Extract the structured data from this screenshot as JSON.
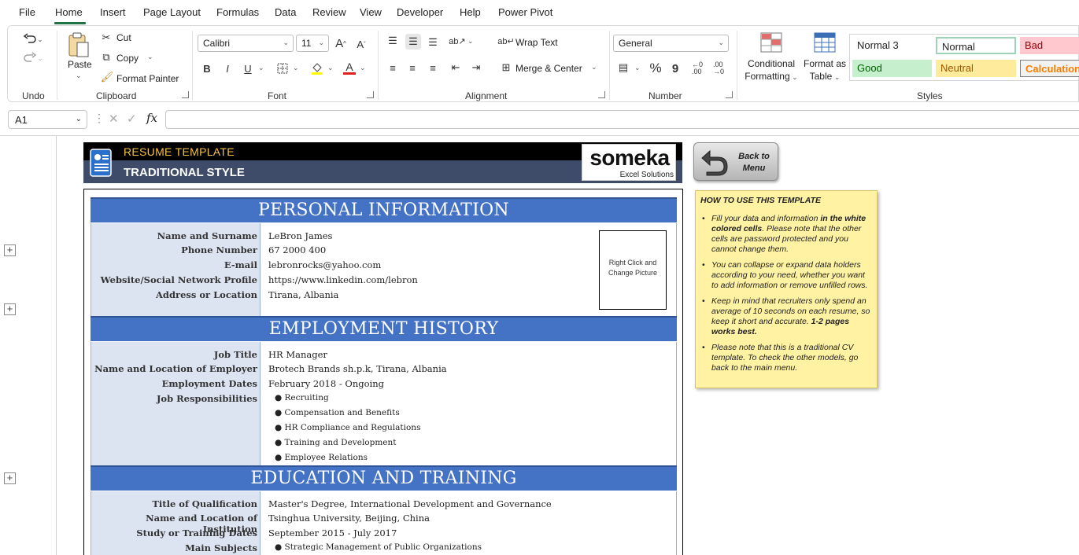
{
  "menu": {
    "items": [
      "File",
      "Home",
      "Insert",
      "Page Layout",
      "Formulas",
      "Data",
      "Review",
      "View",
      "Developer",
      "Help",
      "Power Pivot"
    ],
    "active": "Home"
  },
  "ribbon": {
    "undo": {
      "group_label": "Undo"
    },
    "clipboard": {
      "group_label": "Clipboard",
      "paste": "Paste",
      "cut": "Cut",
      "copy": "Copy",
      "format_painter": "Format Painter"
    },
    "font": {
      "group_label": "Font",
      "font_name": "Calibri",
      "font_size": "11",
      "bold": "B",
      "italic": "I",
      "underline": "U"
    },
    "alignment": {
      "group_label": "Alignment",
      "wrap_text": "Wrap Text",
      "merge_center": "Merge & Center"
    },
    "number": {
      "group_label": "Number",
      "format": "General",
      "percent": "%",
      "comma": "9"
    },
    "styles_group": {
      "group_label": "Styles",
      "conditional": [
        "Conditional",
        "Formatting"
      ],
      "format_as_table": [
        "Format as",
        "Table"
      ],
      "cells": {
        "normal3": "Normal 3",
        "normal": "Normal",
        "bad": "Bad",
        "good": "Good",
        "neutral": "Neutral",
        "calculation": "Calculation"
      }
    }
  },
  "formula_bar": {
    "name_box": "A1",
    "fx": "fx",
    "value": ""
  },
  "header": {
    "subtitle": "RESUME TEMPLATE",
    "title": "TRADITIONAL STYLE",
    "logo_name": "someka",
    "logo_tagline": "Excel Solutions"
  },
  "back_button": {
    "line1": "Back to",
    "line2": "Menu"
  },
  "resume": {
    "personal": {
      "heading": "PERSONAL INFORMATION",
      "rows": [
        {
          "label": "Name and Surname",
          "value": "LeBron James"
        },
        {
          "label": "Phone Number",
          "value": "67 2000 400"
        },
        {
          "label": "E-mail",
          "value": "lebronrocks@yahoo.com"
        },
        {
          "label": "Website/Social Network Profile",
          "value": "https://www.linkedin.com/lebron"
        },
        {
          "label": "Address or Location",
          "value": "Tirana, Albania"
        }
      ],
      "photo_text": [
        "Right Click and",
        "Change Picture"
      ]
    },
    "employment": {
      "heading": "EMPLOYMENT HISTORY",
      "rows": [
        {
          "label": "Job Title",
          "value": "HR Manager"
        },
        {
          "label": "Name and Location of Employer",
          "value": "Brotech Brands sh.p.k, Tirana, Albania"
        },
        {
          "label": "Employment Dates",
          "value": "February 2018 - Ongoing"
        },
        {
          "label": "Job Responsibilities",
          "value": ""
        }
      ],
      "responsibilities": [
        "● Recruiting",
        "● Compensation and Benefits",
        "● HR Compliance and Regulations",
        "● Training and Development",
        "● Employee Relations"
      ]
    },
    "education": {
      "heading": "EDUCATION AND TRAINING",
      "rows": [
        {
          "label": "Title of Qualification",
          "value": "Master's Degree, International Development and Governance"
        },
        {
          "label": "Name and Location of Institution",
          "value": "Tsinghua University, Beijing, China"
        },
        {
          "label": "Study or Training Dates",
          "value": "September 2015 - July 2017"
        },
        {
          "label": "Main Subjects",
          "value": ""
        }
      ],
      "subjects": [
        "● Strategic Management of Public Organizations"
      ]
    }
  },
  "howto": {
    "title": "HOW TO USE THIS TEMPLATE",
    "items": [
      {
        "pre": "Fill your data and information ",
        "bold": "in the white colored cells",
        "post": ". Please note that the other cells are password protected and you cannot change them.",
        "bold2": ""
      },
      {
        "pre": "You can collapse or expand data holders according to your need, whether you want to add information or remove unfilled rows.",
        "bold": "",
        "post": "",
        "bold2": ""
      },
      {
        "pre": "Keep in mind that recruiters only spend an average of 10 seconds on each resume, so keep it short and accurate. ",
        "bold": "",
        "post": "",
        "bold2": "1-2 pages works best."
      },
      {
        "pre": "Please note that this is a traditional CV template. To check the other models, go back to the main menu.",
        "bold": "",
        "post": "",
        "bold2": ""
      }
    ]
  },
  "colors": {
    "section_blue": "#4472c4",
    "label_bg": "#dce4f2",
    "header_band": "#3e4c69",
    "header_gold": "#f6c343",
    "note_yellow": "#fff2a2"
  }
}
